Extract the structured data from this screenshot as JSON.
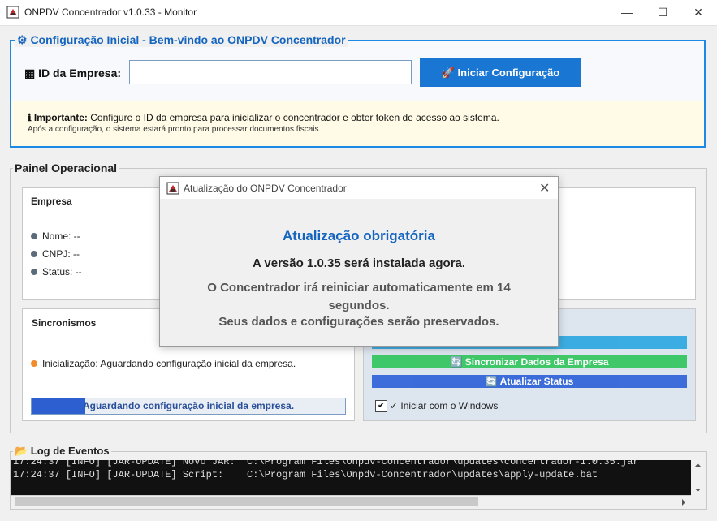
{
  "window": {
    "title": "ONPDV Concentrador v1.0.33 - Monitor",
    "minimize": "—",
    "maximize": "☐",
    "close": "✕"
  },
  "config": {
    "legend": "⚙ Configuração Inicial - Bem-vindo ao ONPDV Concentrador",
    "id_label": "▦ ID da Empresa:",
    "id_value": "",
    "start_button": "🚀 Iniciar Configuração",
    "notice_bold": "ℹ Importante:",
    "notice_text": " Configure o ID da empresa para inicializar o concentrador e obter token de acesso ao sistema.",
    "notice_sub": "Após a configuração, o sistema estará pronto para processar documentos fiscais."
  },
  "painel": {
    "legend": "Painel Operacional",
    "empresa": {
      "title": "Empresa",
      "nome": "Nome: --",
      "cnpj": "CNPJ: --",
      "status": "Status: --"
    },
    "sincronismos": {
      "title": "Sincronismos",
      "status": "Inicialização: Aguardando configuração inicial da empresa.",
      "status_color": "#f08c2a",
      "progress_text": "Aguardando configuração inicial da empresa.",
      "progress": 0.17
    },
    "actions": {
      "btn1": "s/Clientes",
      "btn1_color": "#2aa6e0",
      "btn2": "🔄 Sincronizar Dados da Empresa",
      "btn2_color": "#2ec45a",
      "btn3": "🔄 Atualizar Status",
      "btn3_color": "#2a5fd8",
      "checkbox_checked": true,
      "checkbox_label": "✓ Iniciar com o Windows"
    }
  },
  "log": {
    "legend": "📂 Log de Eventos",
    "lines": [
      "17:24:37 [INFO] [JAR-UPDATE] Novo JAR:  C:\\Program Files\\Onpdv-Concentrador\\updates\\concentrador-1.0.35.jar",
      "17:24:37 [INFO] [JAR-UPDATE] Script:    C:\\Program Files\\Onpdv-Concentrador\\updates\\apply-update.bat"
    ]
  },
  "dialog": {
    "title": "Atualização do ONPDV Concentrador",
    "heading": "Atualização obrigatória",
    "line1": "A versão 1.0.35 será instalada agora.",
    "line2": "O Concentrador irá reiniciar automaticamente em 14",
    "line3": "segundos.",
    "line4": "Seus dados e configurações serão preservados."
  }
}
